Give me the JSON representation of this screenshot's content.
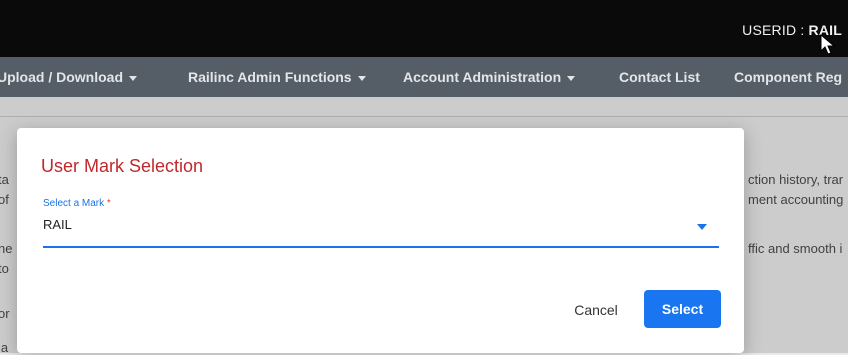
{
  "header": {
    "userid_label": "USERID : ",
    "userid_value": "RAIL"
  },
  "nav": {
    "items": [
      {
        "label": "Upload / Download",
        "has_caret": true
      },
      {
        "label": "Railinc Admin Functions",
        "has_caret": true
      },
      {
        "label": "Account Administration",
        "has_caret": true
      },
      {
        "label": "Contact List",
        "has_caret": false
      },
      {
        "label": "Component Reg",
        "has_caret": false
      }
    ]
  },
  "background": {
    "left_fragments": [
      "ta",
      "of",
      "ne",
      "to",
      "or",
      "la"
    ],
    "right_fragments": [
      "ction history, trar",
      "ment accounting",
      "ffic and smooth i"
    ]
  },
  "modal": {
    "title": "User Mark Selection",
    "field_label": "Select a Mark",
    "required_marker": "*",
    "selected_value": "RAIL",
    "cancel_label": "Cancel",
    "select_label": "Select"
  },
  "colors": {
    "topbar": "#0a0a0a",
    "navbar": "#555e66",
    "title": "#c0282d",
    "accent": "#1976f0"
  }
}
